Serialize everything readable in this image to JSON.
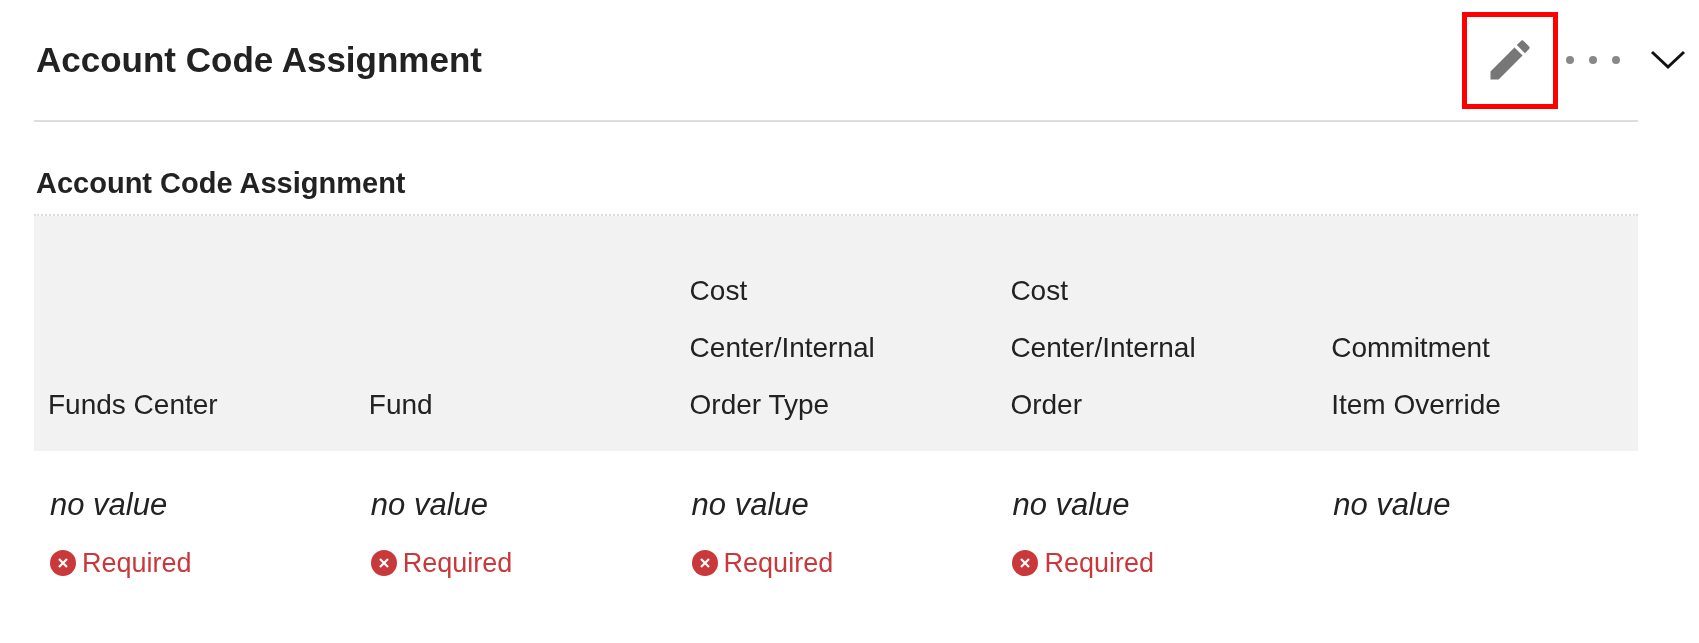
{
  "header": {
    "title": "Account Code Assignment",
    "edit_highlighted": true
  },
  "section": {
    "title": "Account Code Assignment"
  },
  "columns": [
    {
      "label": "Funds Center",
      "value": "no value",
      "required": true,
      "message": "Required"
    },
    {
      "label": "Fund",
      "value": "no value",
      "required": true,
      "message": "Required"
    },
    {
      "label": "Cost Center/Internal Order Type",
      "value": "no value",
      "required": true,
      "message": "Required"
    },
    {
      "label": "Cost Center/Internal Order",
      "value": "no value",
      "required": true,
      "message": "Required"
    },
    {
      "label": "Commitment Item Override",
      "value": "no value",
      "required": false
    }
  ]
}
